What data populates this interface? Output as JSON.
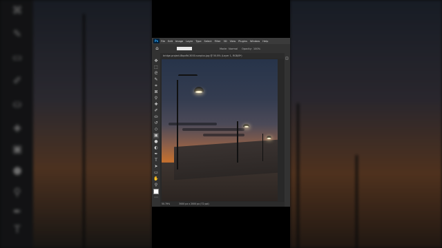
{
  "app": {
    "menu": [
      "File",
      "Edit",
      "Image",
      "Layer",
      "Type",
      "Select",
      "Filter",
      "3D",
      "View",
      "Plugins",
      "Window",
      "Help"
    ],
    "logo": "Ps"
  },
  "options_bar": {
    "mode_label": "Mode:",
    "mode_value": "Normal",
    "opacity_label": "Opacity:",
    "opacity_value": "100%"
  },
  "document_tab": {
    "title": "bridge-project-8bpdfd.3000-sunplus.jpg @ 50.8% (Layer 1, RGB/8*)"
  },
  "status_bar": {
    "zoom": "50.79%",
    "doc_info": "3000 px x 2000 px (72 ppi)"
  },
  "icons": {
    "home": "home-icon",
    "layers": "layers-icon",
    "tools": [
      "move-icon",
      "marquee-icon",
      "lasso-icon",
      "quick-select-icon",
      "crop-icon",
      "frame-icon",
      "eyedropper-icon",
      "healing-icon",
      "brush-icon",
      "stamp-icon",
      "history-brush-icon",
      "eraser-icon",
      "gradient-icon",
      "blur-icon",
      "dodge-icon",
      "pen-icon",
      "type-icon",
      "path-select-icon",
      "shape-icon",
      "hand-icon",
      "zoom-icon",
      "more-tools-icon"
    ]
  },
  "colors": {
    "panel": "#323232",
    "menubar": "#3b3b3b",
    "accent": "#31a8ff",
    "foreground_swatch": "#ffffff"
  }
}
